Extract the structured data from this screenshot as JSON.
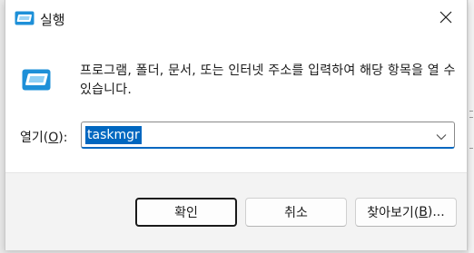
{
  "window": {
    "title": "실행",
    "close_glyph": "✕"
  },
  "body": {
    "description": "프로그램, 폴더, 문서, 또는 인터넷 주소를 입력하여 해당 항목을 열 수 있습니다."
  },
  "open_field": {
    "label_prefix": "열기(",
    "label_mnemonic": "O",
    "label_suffix": "):",
    "value": "taskmgr"
  },
  "buttons": {
    "ok": "확인",
    "cancel": "취소",
    "browse_prefix": "찾아보기(",
    "browse_mnemonic": "B",
    "browse_suffix": ")..."
  },
  "colors": {
    "accent": "#0067c0",
    "icon_blue": "#1e90d8"
  },
  "icons": {
    "title": "run-icon",
    "body": "run-icon",
    "close": "close-icon",
    "dropdown": "chevron-down-icon"
  }
}
